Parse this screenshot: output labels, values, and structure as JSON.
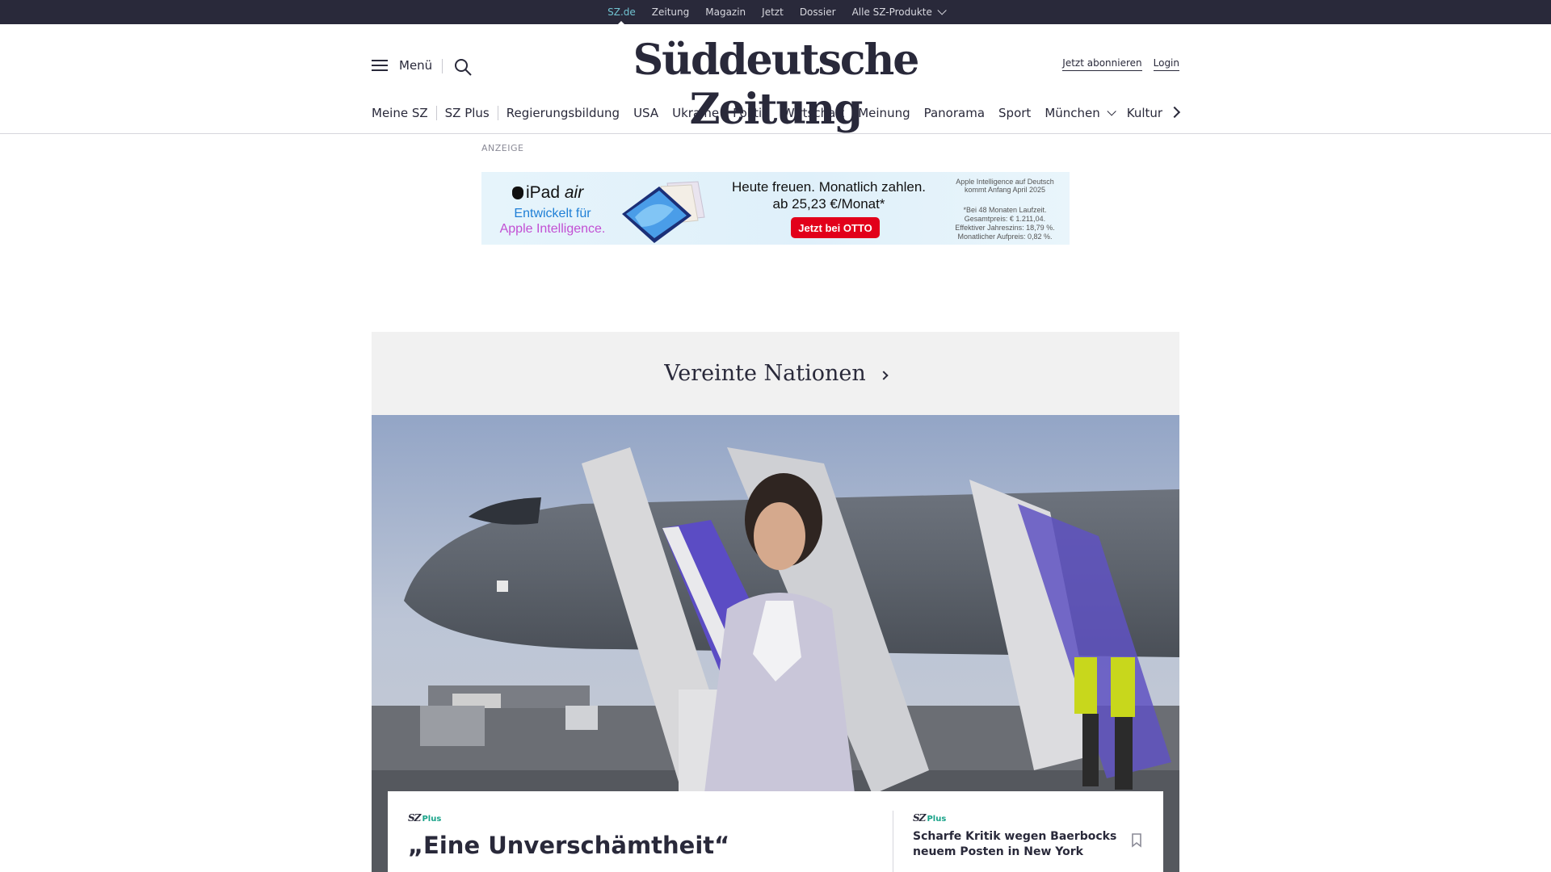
{
  "topbar": {
    "links": [
      {
        "label": "SZ.de",
        "active": true
      },
      {
        "label": "Zeitung"
      },
      {
        "label": "Magazin"
      },
      {
        "label": "Jetzt"
      },
      {
        "label": "Dossier"
      },
      {
        "label": "Alle SZ-Produkte",
        "has_dropdown": true
      }
    ]
  },
  "header": {
    "menu_label": "Menü",
    "logo": "Süddeutsche Zeitung",
    "subscribe_label": "Jetzt abonnieren",
    "login_label": "Login"
  },
  "nav": {
    "items": [
      "Meine SZ",
      "SZ Plus",
      "Regierungsbildung",
      "USA",
      "Ukraine",
      "Politik",
      "Wirtschaft",
      "Meinung",
      "Panorama",
      "Sport",
      "München",
      "Kultur"
    ]
  },
  "ad": {
    "label": "ANZEIGE",
    "brand": "iPad",
    "brand_model": "air",
    "tagline_1": "Entwickelt für",
    "tagline_2": "Apple Intelligence.",
    "headline_1": "Heute freuen. Monatlich zahlen.",
    "headline_2": "ab 25,23 €/Monat*",
    "cta": "Jetzt bei OTTO",
    "fine_1": "Apple Intelligence auf Deutsch kommt Anfang April 2025",
    "fine_2": "*Bei 48 Monaten Laufzeit. Gesamtpreis: € 1.211,04. Effektiver Jahreszins: 18,79 %. Monatlicher Aufpreis: 0,82 %.",
    "colors": {
      "cta": "#e2001a",
      "tagline_1": "#1f7fd6",
      "tagline_2": "#c24fd3"
    }
  },
  "topic": {
    "title": "Vereinte Nationen"
  },
  "card": {
    "badge_sz": "SZ",
    "badge_plus": "Plus",
    "headline": "„Eine Unverschämtheit“",
    "side_headline": "Scharfe Kritik wegen Baerbocks neuem Posten in New York"
  },
  "colors": {
    "topbar_bg": "#29293a",
    "active_link": "#71c3d1",
    "plus_green": "#19a389",
    "topic_bg": "#f1f1f1"
  }
}
